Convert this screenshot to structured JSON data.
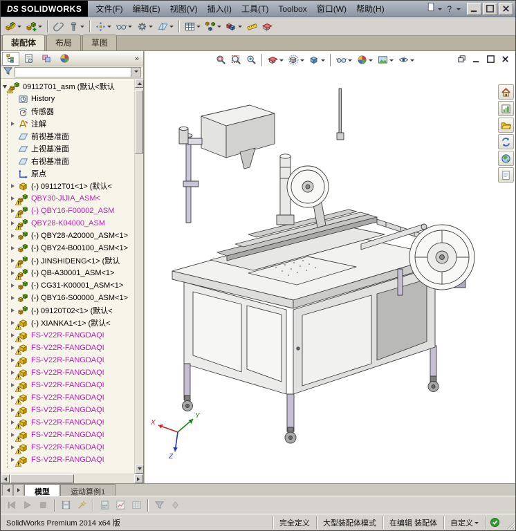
{
  "titlebar": {
    "brand_prefix": "DS",
    "brand": "SOLIDWORKS",
    "menus": [
      "文件(F)",
      "编辑(E)",
      "视图(V)",
      "插入(I)",
      "工具(T)",
      "Toolbox",
      "窗口(W)",
      "帮助(H)"
    ],
    "quick_help": "?",
    "new_doc_icon": "newdoc",
    "window_controls": [
      {
        "name": "minimize-button",
        "icon": "dc-min"
      },
      {
        "name": "maximize-button",
        "icon": "dc-max"
      },
      {
        "name": "close-button",
        "icon": "dc-close"
      }
    ]
  },
  "toolbar": {
    "icons": [
      {
        "name": "edit-component-button",
        "icon": "tb-assembly",
        "drop": true
      },
      {
        "name": "insert-component-button",
        "icon": "tb-insert",
        "drop": true
      },
      {
        "sep": true
      },
      {
        "name": "mate-button",
        "icon": "tb-clip"
      },
      {
        "name": "smart-fastener-button",
        "icon": "tb-fastener",
        "drop": true
      },
      {
        "sep": true
      },
      {
        "name": "move-component-button",
        "icon": "tb-move",
        "drop": true
      },
      {
        "name": "show-hidden-components-button",
        "icon": "tb-hideshow",
        "drop": true
      },
      {
        "name": "assembly-features-button",
        "icon": "tb-feature",
        "drop": true
      },
      {
        "name": "reference-geometry-button",
        "icon": "tb-refgeo",
        "drop": true
      },
      {
        "sep": true
      },
      {
        "name": "bill-of-materials-button",
        "icon": "tb-bom",
        "drop": true
      },
      {
        "name": "exploded-view-button",
        "icon": "tb-explode",
        "drop": true
      },
      {
        "name": "interference-detection-button",
        "icon": "tb-interfere",
        "drop": true
      },
      {
        "name": "measure-button",
        "icon": "tb-measure"
      },
      {
        "name": "section-button",
        "icon": "tb-section"
      }
    ]
  },
  "command_tabs": [
    {
      "label": "装配体",
      "active": true
    },
    {
      "label": "布局",
      "active": false
    },
    {
      "label": "草图",
      "active": false
    }
  ],
  "panel": {
    "header_icons": [
      {
        "name": "featuremanager-tab",
        "icon": "p-tree"
      },
      {
        "name": "propertymanager-tab",
        "icon": "p-props"
      },
      {
        "name": "configurationmanager-tab",
        "icon": "p-config"
      },
      {
        "name": "appearances-tab",
        "icon": "p-appear"
      }
    ],
    "overflow": "»",
    "filter_icon": "filter",
    "tree": {
      "root": {
        "label": "09112T01_asm (默认<默认",
        "icon": "assembly",
        "warn": true
      },
      "items": [
        {
          "label": "History",
          "icon": "history"
        },
        {
          "label": "传感器",
          "icon": "sensor"
        },
        {
          "label": "注解",
          "icon": "annotation",
          "exp": true
        },
        {
          "label": "前视基准面",
          "icon": "plane"
        },
        {
          "label": "上视基准面",
          "icon": "plane"
        },
        {
          "label": "右视基准面",
          "icon": "plane"
        },
        {
          "label": "原点",
          "icon": "origin"
        },
        {
          "label": "(-) 09112T01<1> (默认<",
          "icon": "part",
          "exp": true
        },
        {
          "label": "QBY30-JIJIA_ASM<",
          "icon": "assembly",
          "warn": true,
          "mag": true,
          "exp": true
        },
        {
          "label": "(-) QBY16-F00002_ASM",
          "icon": "assembly",
          "warn": true,
          "mag": true,
          "exp": true
        },
        {
          "label": "QBY28-K04000_ASM",
          "icon": "assembly",
          "warn": true,
          "mag": true,
          "exp": true
        },
        {
          "label": "(-) QBY28-A20000_ASM<1>",
          "icon": "assembly",
          "exp": true
        },
        {
          "label": "(-) QBY24-B00100_ASM<1>",
          "icon": "assembly",
          "exp": true
        },
        {
          "label": "(-) JINSHIDENG<1> (默认",
          "icon": "assembly",
          "warn": true,
          "exp": true
        },
        {
          "label": "(-) QB-A30001_ASM<1>",
          "icon": "assembly",
          "warn": true,
          "exp": true
        },
        {
          "label": "(-) CG31-K00001_ASM<1>",
          "icon": "assembly",
          "exp": true
        },
        {
          "label": "(-) QBY16-S00000_ASM<1>",
          "icon": "assembly",
          "exp": true
        },
        {
          "label": "(-) 09120T02<1> (默认<",
          "icon": "assembly",
          "exp": true
        },
        {
          "label": "(-) XIANKA1<1> (默认<",
          "icon": "part",
          "warn": true,
          "exp": true
        },
        {
          "label": "FS-V22R-FANGDAQI",
          "icon": "part",
          "warn": true,
          "mag": true,
          "exp": true
        },
        {
          "label": "FS-V22R-FANGDAQI",
          "icon": "part",
          "warn": true,
          "mag": true,
          "exp": true
        },
        {
          "label": "FS-V22R-FANGDAQI",
          "icon": "part",
          "warn": true,
          "mag": true,
          "exp": true
        },
        {
          "label": "FS-V22R-FANGDAQI",
          "icon": "part",
          "warn": true,
          "mag": true,
          "exp": true
        },
        {
          "label": "FS-V22R-FANGDAQI",
          "icon": "part",
          "warn": true,
          "mag": true,
          "exp": true
        },
        {
          "label": "FS-V22R-FANGDAQI",
          "icon": "part",
          "warn": true,
          "mag": true,
          "exp": true
        },
        {
          "label": "FS-V22R-FANGDAQI",
          "icon": "part",
          "warn": true,
          "mag": true,
          "exp": true
        },
        {
          "label": "FS-V22R-FANGDAQI",
          "icon": "part",
          "warn": true,
          "mag": true,
          "exp": true
        },
        {
          "label": "FS-V22R-FANGDAQI",
          "icon": "part",
          "warn": true,
          "mag": true,
          "exp": true
        },
        {
          "label": "FS-V22R-FANGDAQI",
          "icon": "part",
          "warn": true,
          "mag": true,
          "exp": true
        },
        {
          "label": "FS-V22R-FANGDAQI",
          "icon": "part",
          "warn": true,
          "mag": true,
          "exp": true
        }
      ]
    }
  },
  "viewport": {
    "toolbar": [
      {
        "name": "zoom-fit-button",
        "icon": "v-zoomfit"
      },
      {
        "name": "zoom-area-button",
        "icon": "v-zoomarea"
      },
      {
        "name": "zoom-button",
        "icon": "v-zoom"
      },
      {
        "sep": true
      },
      {
        "name": "section-view-button",
        "icon": "v-section",
        "drop": true
      },
      {
        "name": "view-orientation-button",
        "icon": "v-orient",
        "drop": true
      },
      {
        "name": "display-style-button",
        "icon": "v-display",
        "drop": true
      },
      {
        "sep": true
      },
      {
        "name": "hide-show-items-button",
        "icon": "v-hideshow",
        "drop": true
      },
      {
        "name": "edit-appearance-button",
        "icon": "v-appearance",
        "drop": true
      },
      {
        "name": "apply-scene-button",
        "icon": "v-scene",
        "drop": true
      },
      {
        "name": "view-settings-button",
        "icon": "v-eye",
        "drop": true
      }
    ],
    "doc_controls": [
      {
        "name": "doc-restore-button",
        "icon": "dc-restore"
      },
      {
        "name": "doc-minimize-button",
        "icon": "dc-min"
      },
      {
        "name": "doc-maximize-button",
        "icon": "dc-max"
      },
      {
        "name": "doc-close-button",
        "icon": "dc-close"
      }
    ],
    "right_rail": [
      {
        "name": "home-button",
        "icon": "r-home"
      },
      {
        "name": "performance-evaluation-button",
        "icon": "r-chart"
      },
      {
        "name": "open-folder-button",
        "icon": "r-folder"
      },
      {
        "name": "update-button",
        "icon": "r-refresh"
      },
      {
        "name": "online-resources-button",
        "icon": "r-globe"
      },
      {
        "name": "notes-button",
        "icon": "r-note"
      }
    ],
    "triad": {
      "x": "X",
      "y": "Y",
      "z": "Z"
    }
  },
  "bottom_tabs": {
    "tabs": [
      {
        "label": "模型",
        "active": true
      },
      {
        "label": "运动算例1",
        "active": false
      }
    ]
  },
  "motion_toolbar": {
    "icons": [
      {
        "name": "motion-jump-to-start-button",
        "icon": "m-start"
      },
      {
        "name": "motion-play-button",
        "icon": "m-play"
      },
      {
        "name": "motion-stop-button",
        "icon": "m-stop"
      },
      {
        "sep": true
      },
      {
        "name": "motion-save-animation-button",
        "icon": "m-save"
      },
      {
        "name": "motion-animation-wizard-button",
        "icon": "m-wizard"
      },
      {
        "sep": true
      },
      {
        "name": "motion-calculate-button",
        "icon": "m-calc"
      },
      {
        "name": "motion-results-chart-button",
        "icon": "m-chart"
      },
      {
        "name": "motion-grid-button",
        "icon": "m-grid"
      },
      {
        "sep": true
      },
      {
        "name": "motion-filter-button",
        "icon": "m-filter"
      },
      {
        "name": "motion-key-point-button",
        "icon": "m-key"
      }
    ]
  },
  "statusbar": {
    "left": "SolidWorks Premium 2014 x64 版",
    "segments": [
      {
        "label": "完全定义"
      },
      {
        "label": "大型装配体模式"
      },
      {
        "label": "在编辑 装配体"
      },
      {
        "label": "自定义",
        "drop": true
      }
    ],
    "ok_icon": "status-green"
  },
  "colors": {
    "magenta_item": "#c21ac2",
    "warning_yellow": "#ffd000",
    "accent_purple": "#c6bed4",
    "chrome_gray": "#d6d3ce"
  }
}
